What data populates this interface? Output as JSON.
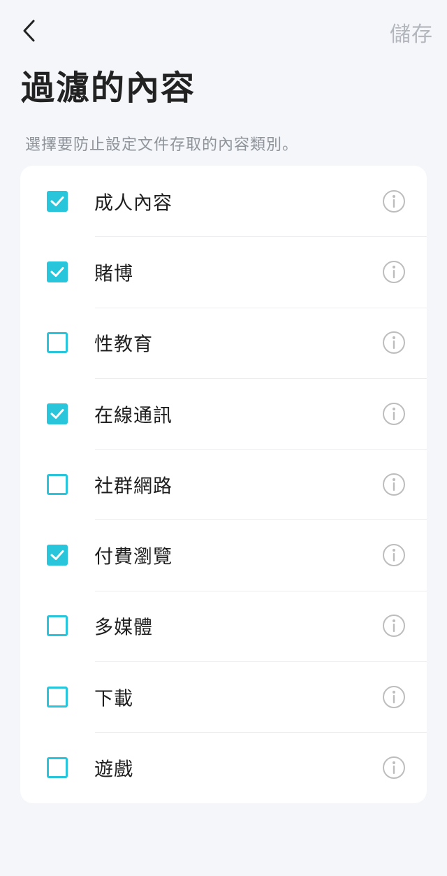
{
  "header": {
    "back_icon": "chevron-left-icon",
    "save_label": "儲存",
    "title": "過濾的內容",
    "subtitle": "選擇要防止設定文件存取的內容類別。"
  },
  "colors": {
    "accent": "#29c6db",
    "disabled_text": "#b3b7bd",
    "background": "#f4f6fa"
  },
  "categories": [
    {
      "label": "成人內容",
      "checked": true,
      "info_icon": "info-circle-icon"
    },
    {
      "label": "賭博",
      "checked": true,
      "info_icon": "info-circle-icon"
    },
    {
      "label": "性教育",
      "checked": false,
      "info_icon": "info-circle-icon"
    },
    {
      "label": "在線通訊",
      "checked": true,
      "info_icon": "info-circle-icon"
    },
    {
      "label": "社群網路",
      "checked": false,
      "info_icon": "info-circle-icon"
    },
    {
      "label": "付費瀏覽",
      "checked": true,
      "info_icon": "info-circle-icon"
    },
    {
      "label": "多媒體",
      "checked": false,
      "info_icon": "info-circle-icon"
    },
    {
      "label": "下載",
      "checked": false,
      "info_icon": "info-circle-icon"
    },
    {
      "label": "遊戲",
      "checked": false,
      "info_icon": "info-circle-icon"
    }
  ]
}
